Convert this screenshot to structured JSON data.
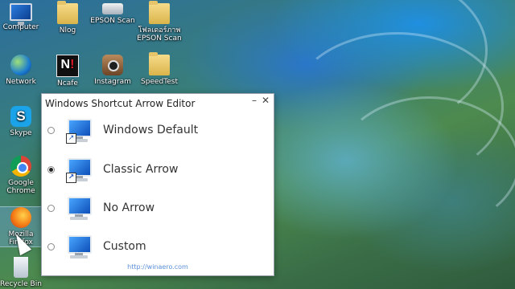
{
  "desktop": {
    "icons": [
      {
        "id": "computer",
        "label": "Computer",
        "icon": "computer-icon"
      },
      {
        "id": "nlog",
        "label": "Nlog",
        "icon": "folder-icon"
      },
      {
        "id": "epson-scan",
        "label": "EPSON Scan",
        "icon": "scanner-icon"
      },
      {
        "id": "epson-folder",
        "label": "โฟลเดอร์ภาพ EPSON Scan",
        "icon": "folder-icon"
      },
      {
        "id": "network",
        "label": "Network",
        "icon": "network-icon"
      },
      {
        "id": "ncafe",
        "label": "Ncafe",
        "icon": "ncafe-icon"
      },
      {
        "id": "instagram",
        "label": "Instagram",
        "icon": "camera-icon"
      },
      {
        "id": "speedtest",
        "label": "SpeedTest",
        "icon": "folder-icon"
      },
      {
        "id": "skype",
        "label": "Skype",
        "icon": "skype-icon"
      },
      {
        "id": "chrome",
        "label": "Google Chrome",
        "icon": "chrome-icon"
      },
      {
        "id": "firefox",
        "label": "Mozilla Firefox",
        "icon": "firefox-icon"
      },
      {
        "id": "recycle-bin",
        "label": "Recycle Bin",
        "icon": "recycle-bin-icon"
      }
    ]
  },
  "dialog": {
    "title": "Windows Shortcut Arrow Editor",
    "minimize_glyph": "–",
    "close_glyph": "✕",
    "options": [
      {
        "label": "Windows Default",
        "selected": false
      },
      {
        "label": "Classic Arrow",
        "selected": true
      },
      {
        "label": "No Arrow",
        "selected": false
      },
      {
        "label": "Custom",
        "selected": false
      }
    ],
    "footer_link": "http://winaero.com"
  }
}
